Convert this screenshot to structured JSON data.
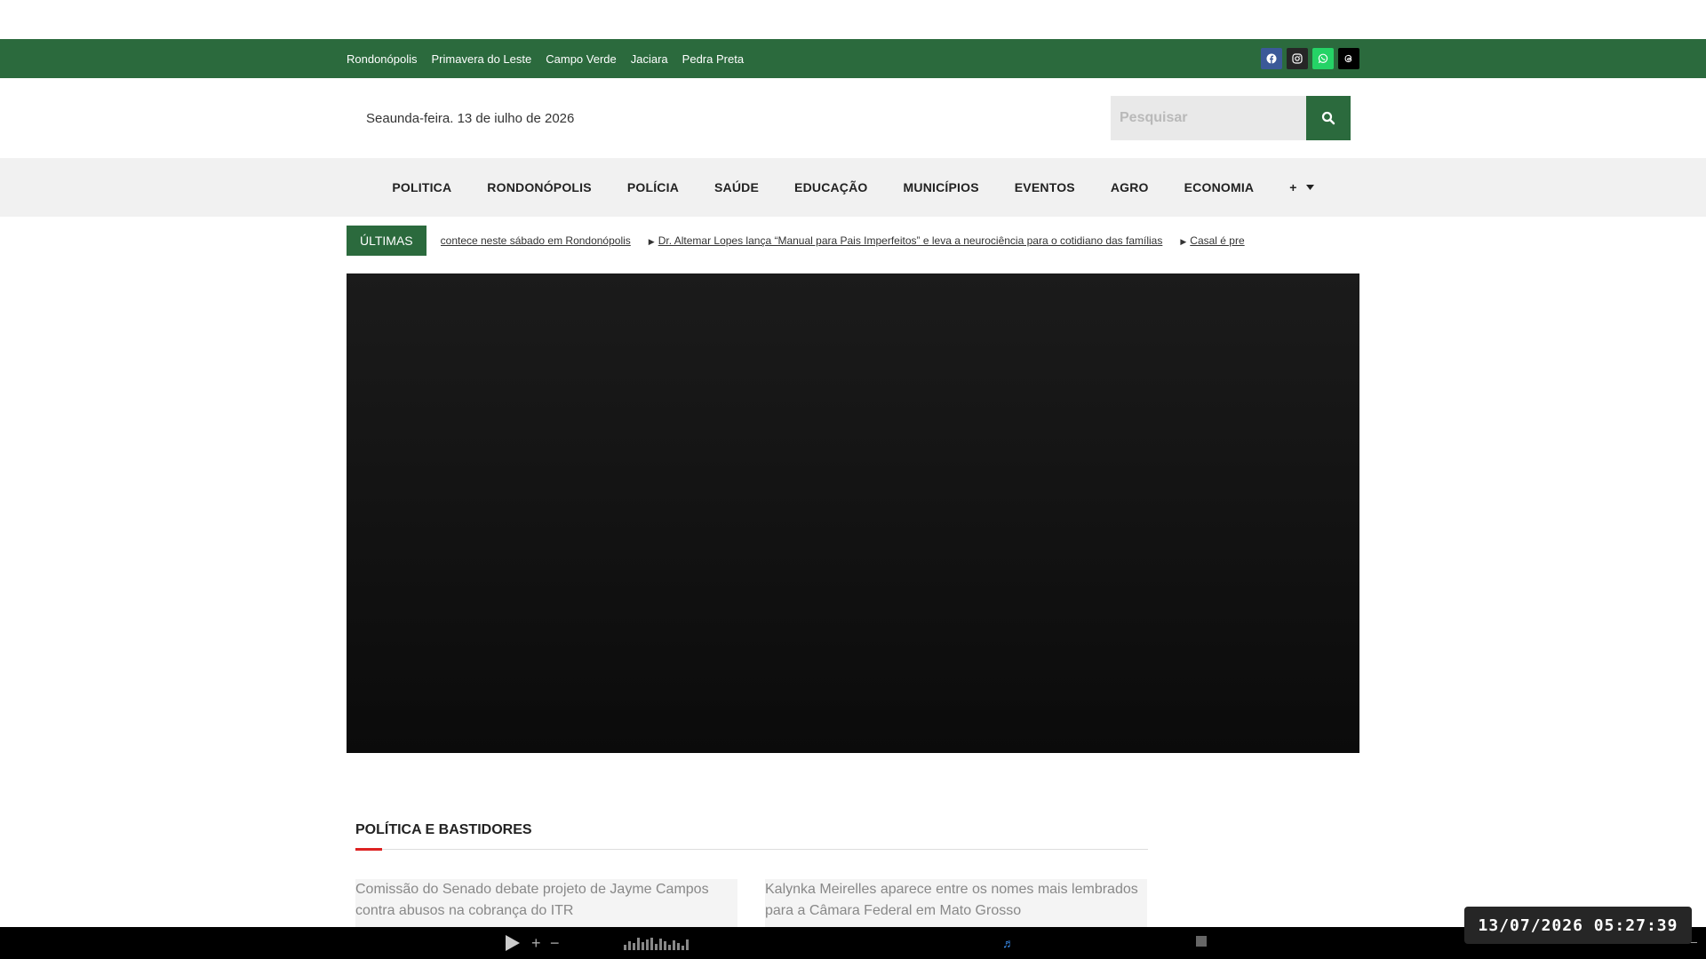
{
  "topbar": {
    "cities": [
      "Rondonópolis",
      "Primavera do Leste",
      "Campo Verde",
      "Jaciara",
      "Pedra Preta"
    ],
    "social": [
      {
        "icon": "facebook-icon",
        "color": "#3b5998"
      },
      {
        "icon": "instagram-icon",
        "color": "#262626"
      },
      {
        "icon": "whatsapp-icon",
        "color": "#25d366"
      },
      {
        "icon": "threads-icon",
        "color": "#000000"
      }
    ]
  },
  "header": {
    "date": "Seaunda-feira. 13 de iulho de 2026",
    "search_placeholder": "Pesquisar"
  },
  "nav": {
    "items": [
      "POLITICA",
      "RONDONÓPOLIS",
      "POLÍCIA",
      "SAÚDE",
      "EDUCAÇÃO",
      "MUNICÍPIOS",
      "EVENTOS",
      "AGRO",
      "ECONOMIA"
    ],
    "more_label": "+"
  },
  "ticker": {
    "label": "ÚLTIMAS",
    "items": [
      "contece neste sábado em Rondonópolis",
      "Dr. Altemar Lopes lança “Manual para Pais Imperfeitos” e leva a neurociência para o cotidiano das famílias",
      "Casal é pre"
    ]
  },
  "section": {
    "title": "POLÍTICA E BASTIDORES",
    "cards": [
      "Comissão do Senado debate projeto de Jayme Campos contra abusos na cobrança do ITR",
      "Kalynka Meirelles aparece entre os nomes mais lembrados para a Câmara Federal em Mato Grosso"
    ]
  },
  "clock": {
    "text": "13/07/2026 05:27:39"
  },
  "colors": {
    "brand_green": "#2b6a3d",
    "accent_red": "#dd2222"
  }
}
